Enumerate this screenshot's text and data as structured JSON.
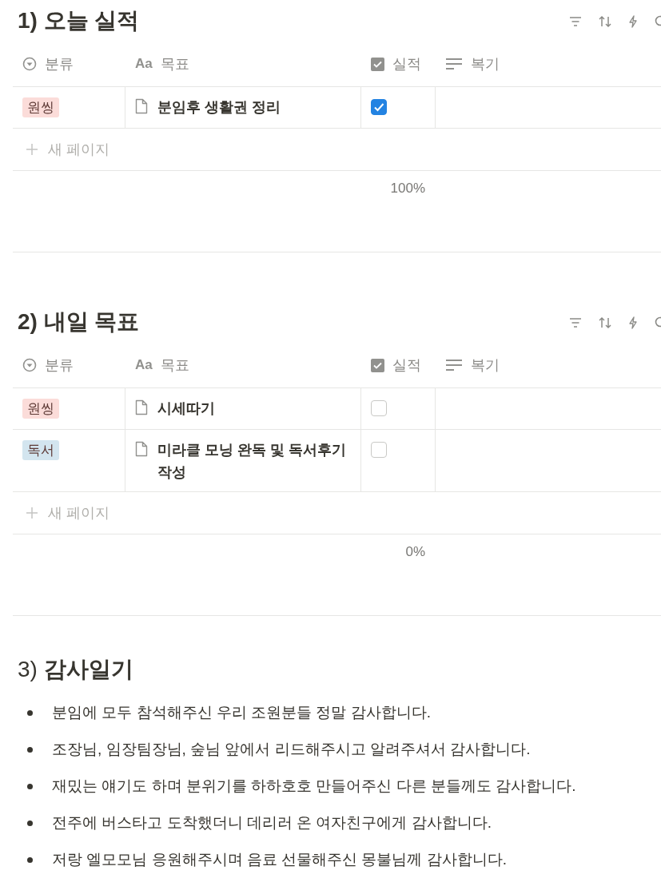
{
  "tables": [
    {
      "title": "1) 오늘 실적",
      "columns": [
        {
          "label": "분류",
          "kind": "select"
        },
        {
          "label": "목표",
          "kind": "title",
          "icon_text": "Aa"
        },
        {
          "label": "실적",
          "kind": "checkbox"
        },
        {
          "label": "복기",
          "kind": "text"
        }
      ],
      "rows": [
        {
          "tag": {
            "label": "원씽",
            "color": "#fbdcd9"
          },
          "goal": "분임후 생활권 정리",
          "checked": true
        }
      ],
      "new_page": "새 페이지",
      "calc": "100%"
    },
    {
      "title": "2) 내일 목표",
      "columns": [
        {
          "label": "분류",
          "kind": "select"
        },
        {
          "label": "목표",
          "kind": "title",
          "icon_text": "Aa"
        },
        {
          "label": "실적",
          "kind": "checkbox"
        },
        {
          "label": "복기",
          "kind": "text"
        }
      ],
      "rows": [
        {
          "tag": {
            "label": "원씽",
            "color": "#fbdcd9"
          },
          "goal": "시세따기",
          "checked": false
        },
        {
          "tag": {
            "label": "독서",
            "color": "#d3e5ef"
          },
          "goal": "미라클 모닝 완독 및 독서후기 작성",
          "checked": false
        }
      ],
      "new_page": "새 페이지",
      "calc": "0%"
    }
  ],
  "gratitude": {
    "title": "3) **감사일기**",
    "items": [
      "분임에 모두 참석해주신 우리 조원분들 정말 감사합니다.",
      "조장님, 임장팀장님, 숲님 앞에서 리드해주시고 알려주셔서 감사합니다.",
      "재밌는 얘기도 하며 분위기를 하하호호 만들어주신 다른 분들께도 감사합니다.",
      "전주에 버스타고 도착했더니 데리러 온 여자친구에게 감사합니다.",
      "저랑 엘모모님 응원해주시며 음료 선물해주신 몽불님께 감사합니다."
    ]
  }
}
